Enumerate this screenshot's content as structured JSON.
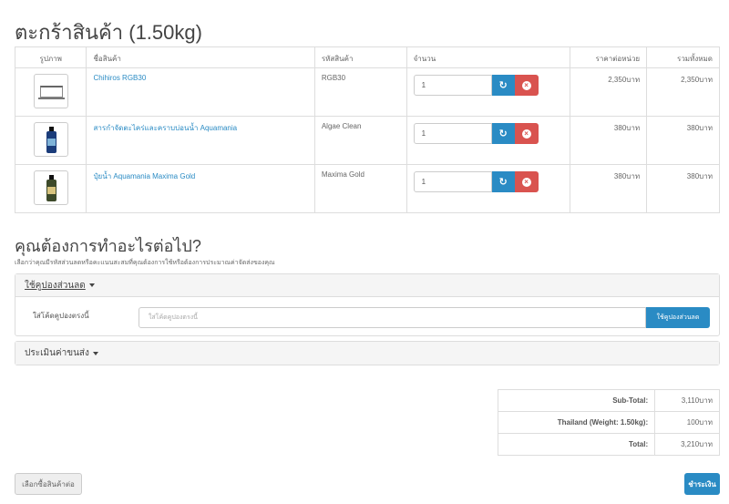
{
  "page_title": "ตะกร้าสินค้า  (1.50kg)",
  "cart": {
    "headers": {
      "image": "รูปภาพ",
      "name": "ชื่อสินค้า",
      "model": "รหัสสินค้า",
      "quantity": "จำนวน",
      "unit_price": "ราคาต่อหน่วย",
      "total": "รวมทั้งหมด"
    },
    "items": [
      {
        "icon": "aquarium-tank-icon",
        "name": "Chihiros RGB30",
        "model": "RGB30",
        "quantity": "1",
        "unit_price": "2,350บาท",
        "total": "2,350บาท"
      },
      {
        "icon": "blue-bottle-icon",
        "name": "สารกำจัดตะไคร่และคราบบ่อนน้ำ Aquamania",
        "model": "Algae Clean",
        "quantity": "1",
        "unit_price": "380บาท",
        "total": "380บาท"
      },
      {
        "icon": "gold-bottle-icon",
        "name": "ปุ๋ยน้ำ Aquamania Maxima Gold",
        "model": "Maxima Gold",
        "quantity": "1",
        "unit_price": "380บาท",
        "total": "380บาท"
      }
    ],
    "refresh_icon": "refresh-icon",
    "remove_icon": "remove-icon"
  },
  "next_section": {
    "title": "คุณต้องการทำอะไรต่อไป?",
    "subtitle": "เลือกว่าคุณมีรหัสส่วนลดหรือคะแนนสะสมที่คุณต้องการใช้หรือต้องการประมาณค่าจัดส่งของคุณ"
  },
  "coupon": {
    "heading": "ใช้คูปองส่วนลด",
    "label": "ใส่โค้ดคูปองตรงนี้",
    "placeholder": "ใส่โค้ดคูปองตรงนี้",
    "button": "ใช้คูปองส่วนลด"
  },
  "shipping": {
    "heading": "ประเมินค่าขนส่ง"
  },
  "totals": [
    {
      "label": "Sub-Total:",
      "value": "3,110บาท"
    },
    {
      "label": "Thailand (Weight: 1.50kg):",
      "value": "100บาท"
    },
    {
      "label": "Total:",
      "value": "3,210บาท"
    }
  ],
  "buttons": {
    "continue": "เลือกซื้อสินค้าต่อ",
    "checkout": "ชำระเงิน"
  },
  "colors": {
    "primary": "#2a8bc4",
    "danger": "#d9534f"
  }
}
